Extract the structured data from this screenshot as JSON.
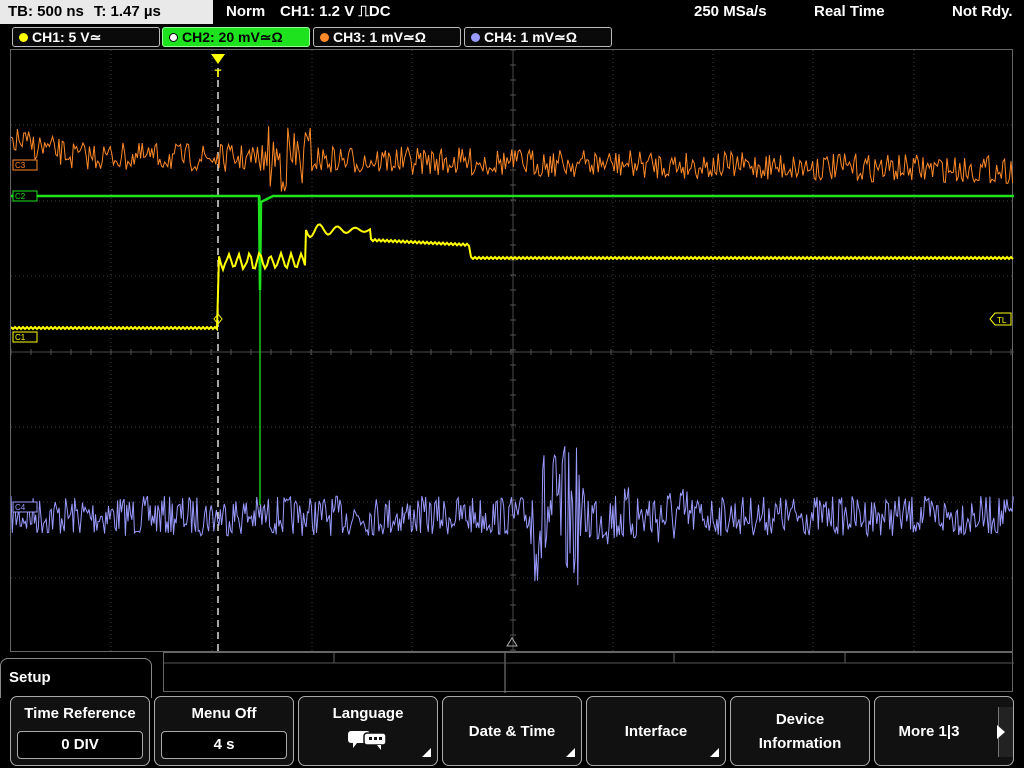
{
  "status": {
    "timebase": "TB: 500 ns",
    "trigger_time": "T: 1.47 µs",
    "mode": "Norm",
    "trigger_info": "CH1: 1.2 V ⎍DC",
    "sample_rate": "250 MSa/s",
    "acq_mode": "Real Time",
    "state": "Not Rdy."
  },
  "channels": [
    {
      "label": "CH1: 5 V≃",
      "color": "#ffff00"
    },
    {
      "label": "CH2: 20 mV≃Ω",
      "color": "#1fe21f"
    },
    {
      "label": "CH3: 1 mV≃Ω",
      "color": "#ff8a2a"
    },
    {
      "label": "CH4: 1 mV≃Ω",
      "color": "#9a9aff"
    }
  ],
  "markers": {
    "c3": "C3",
    "c2": "C2",
    "c1": "C1",
    "c4": "C4",
    "tl": "TL",
    "trigger": "T"
  },
  "menu": {
    "title": "Setup",
    "softkeys": [
      {
        "label": "Time Reference",
        "value": "0 DIV"
      },
      {
        "label": "Menu Off",
        "value": "4 s"
      },
      {
        "label": "Language",
        "icon": "speech-bubbles-icon"
      },
      {
        "label": "Date & Time"
      },
      {
        "label": "Interface"
      },
      {
        "label": "Device",
        "label2": "Information"
      },
      {
        "label": "More 1|3"
      }
    ]
  }
}
